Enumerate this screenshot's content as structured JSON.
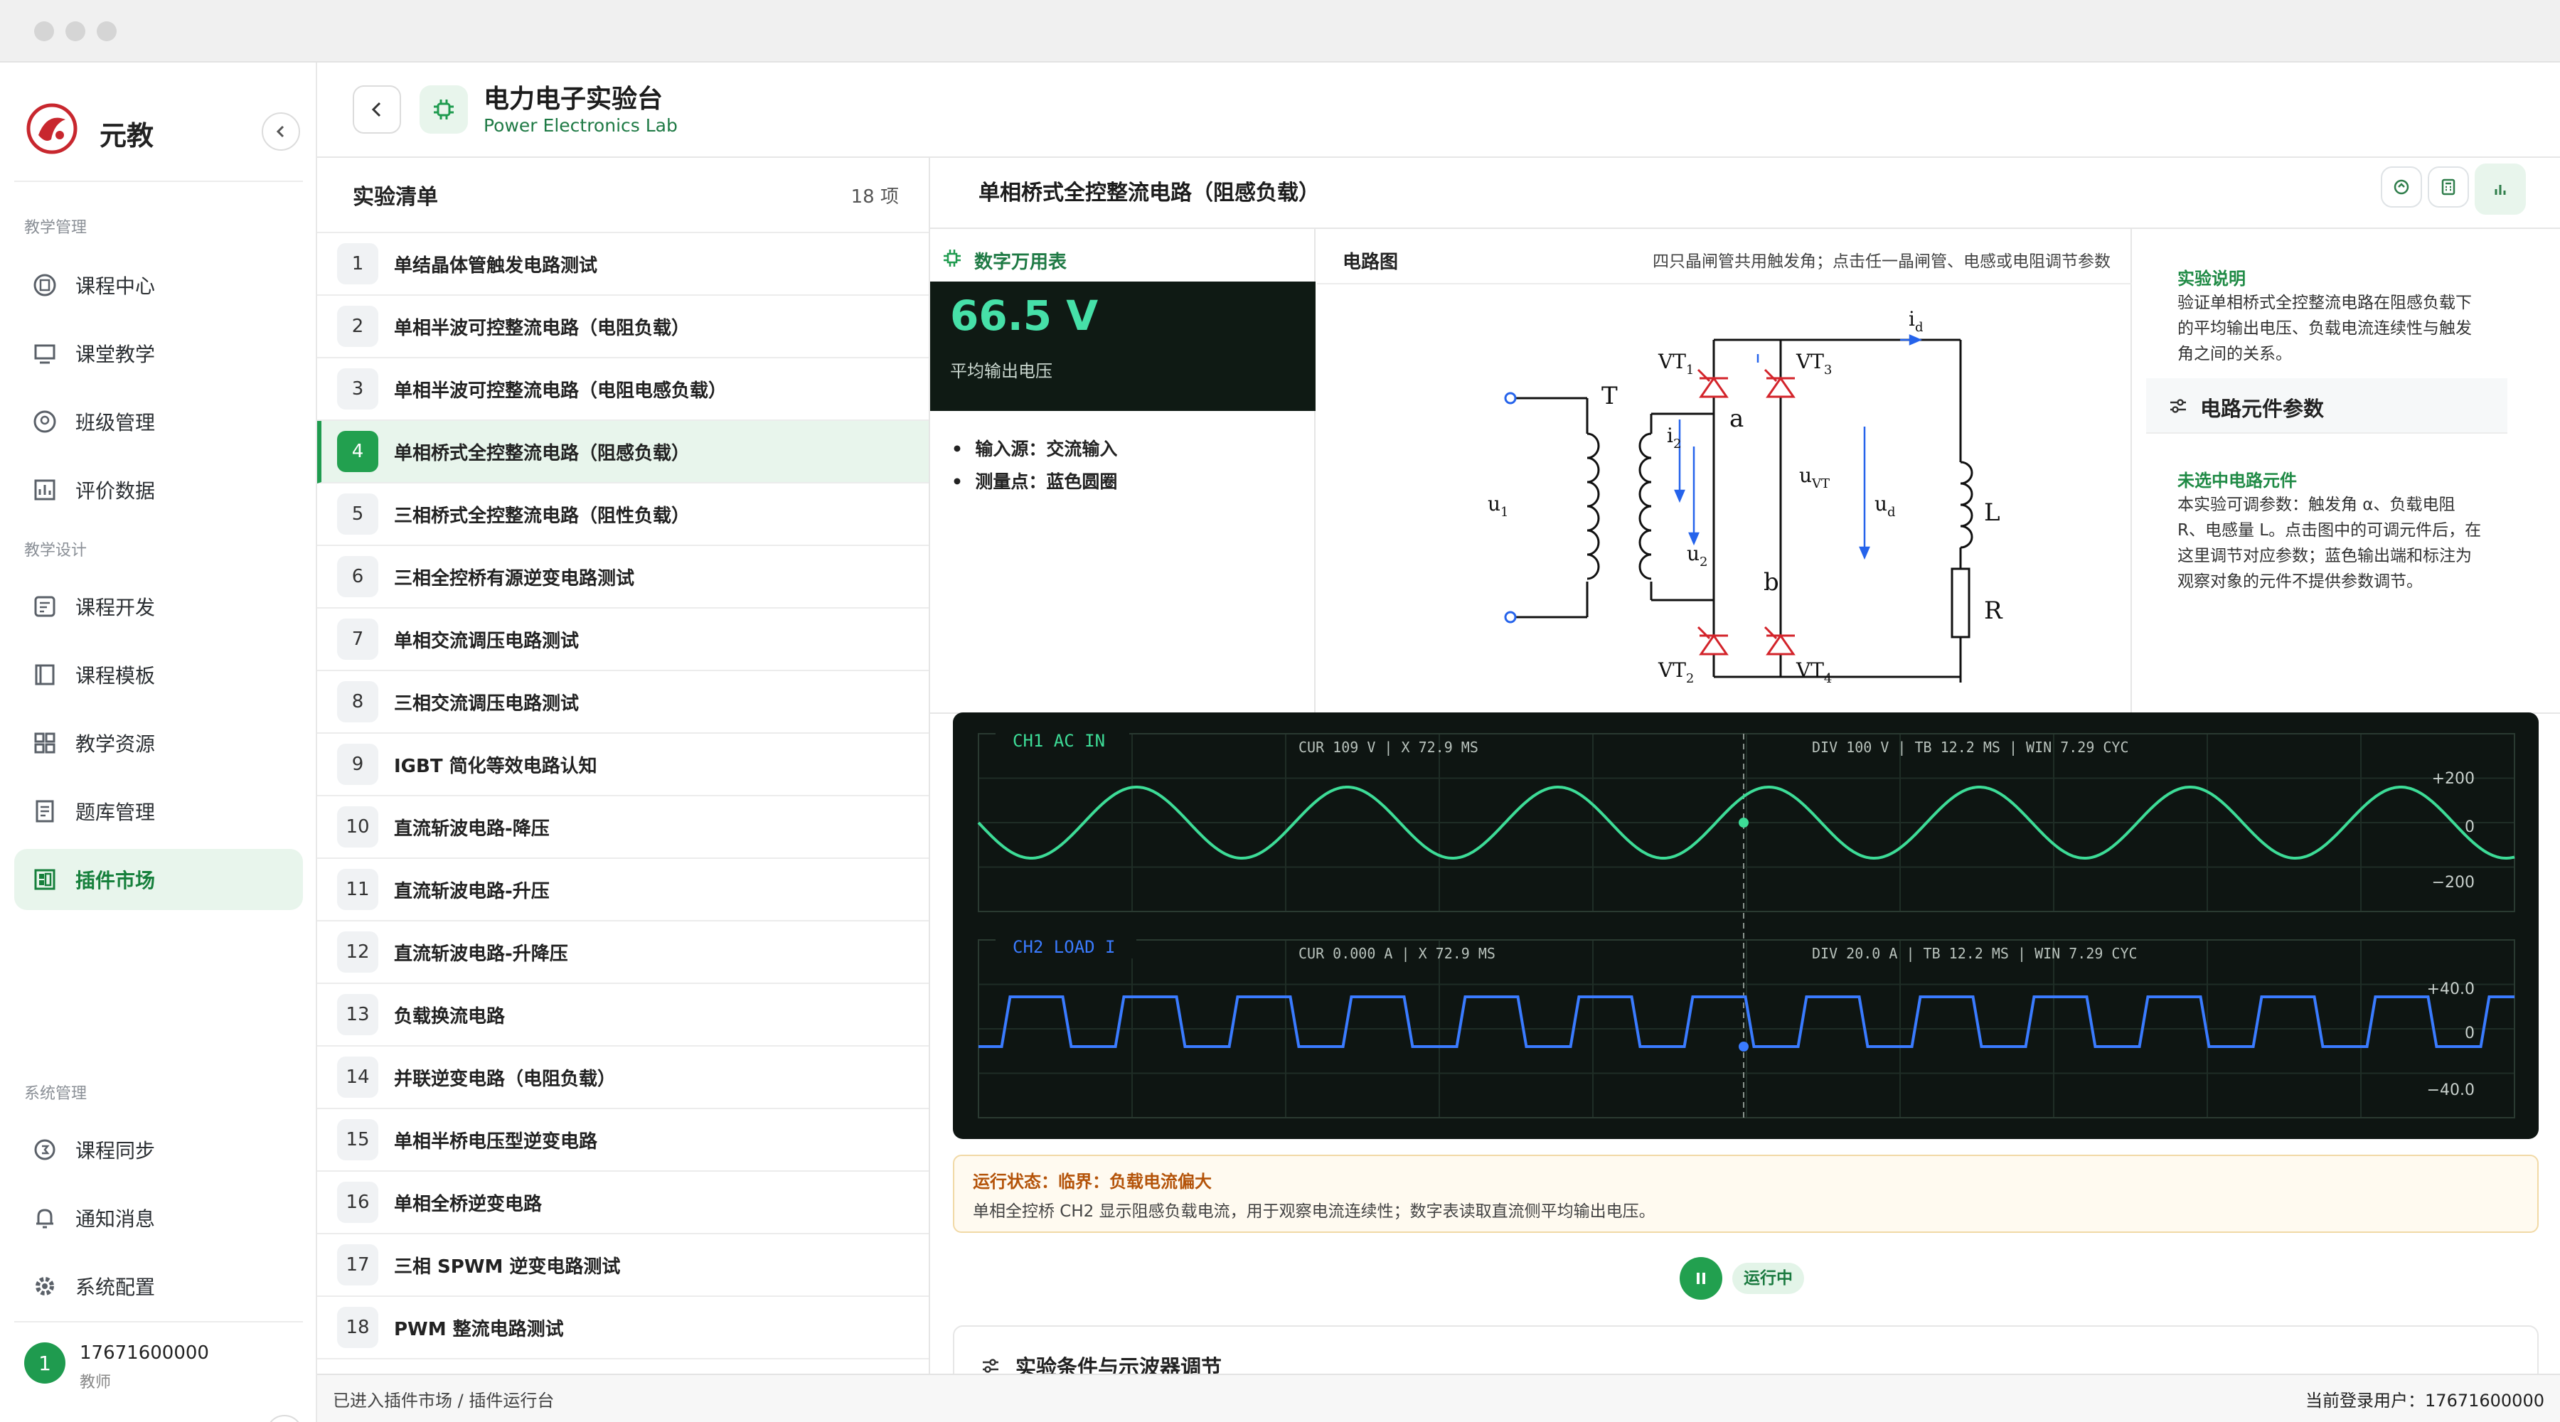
{
  "app": {
    "name": "元教"
  },
  "sidebar": {
    "sections": [
      "教学管理",
      "教学设计",
      "系统管理"
    ],
    "items": [
      {
        "label": "课程中心",
        "icon": "book-icon"
      },
      {
        "label": "课堂教学",
        "icon": "classroom-icon"
      },
      {
        "label": "班级管理",
        "icon": "class-icon"
      },
      {
        "label": "评价数据",
        "icon": "chart-icon"
      },
      {
        "label": "课程开发",
        "icon": "dev-icon"
      },
      {
        "label": "课程模板",
        "icon": "template-icon"
      },
      {
        "label": "教学资源",
        "icon": "resource-icon"
      },
      {
        "label": "题库管理",
        "icon": "question-bank-icon"
      },
      {
        "label": "插件市场",
        "icon": "plugin-icon",
        "active": true
      },
      {
        "label": "课程同步",
        "icon": "sync-icon"
      },
      {
        "label": "通知消息",
        "icon": "bell-icon"
      },
      {
        "label": "系统配置",
        "icon": "gear-icon"
      }
    ],
    "user": {
      "avatar": "1",
      "name": "17671600000",
      "role": "教师"
    }
  },
  "header": {
    "title": "电力电子实验台",
    "subtitle": "Power Electronics Lab"
  },
  "list": {
    "title": "实验清单",
    "count": "18 项",
    "items": [
      {
        "num": "1",
        "label": "单结晶体管触发电路测试"
      },
      {
        "num": "2",
        "label": "单相半波可控整流电路（电阻负载）"
      },
      {
        "num": "3",
        "label": "单相半波可控整流电路（电阻电感负载）"
      },
      {
        "num": "4",
        "label": "单相桥式全控整流电路（阻感负载）"
      },
      {
        "num": "5",
        "label": "三相桥式全控整流电路（阻性负载）"
      },
      {
        "num": "6",
        "label": "三相全控桥有源逆变电路测试"
      },
      {
        "num": "7",
        "label": "单相交流调压电路测试"
      },
      {
        "num": "8",
        "label": "三相交流调压电路测试"
      },
      {
        "num": "9",
        "label": "IGBT 简化等效电路认知"
      },
      {
        "num": "10",
        "label": "直流斩波电路-降压"
      },
      {
        "num": "11",
        "label": "直流斩波电路-升压"
      },
      {
        "num": "12",
        "label": "直流斩波电路-升降压"
      },
      {
        "num": "13",
        "label": "负载换流电路"
      },
      {
        "num": "14",
        "label": "并联逆变电路（电阻负载）"
      },
      {
        "num": "15",
        "label": "单相半桥电压型逆变电路"
      },
      {
        "num": "16",
        "label": "单相全桥逆变电路"
      },
      {
        "num": "17",
        "label": "三相 SPWM 逆变电路测试"
      },
      {
        "num": "18",
        "label": "PWM 整流电路测试"
      }
    ],
    "active_index": 3
  },
  "experiment": {
    "title": "单相桥式全控整流电路（阻感负载）",
    "meter": {
      "title": "数字万用表",
      "value": "66.5 V",
      "label": "平均输出电压",
      "bullets": [
        "输入源：交流输入",
        "测量点：蓝色圆圈"
      ]
    },
    "circuit": {
      "title": "电路图",
      "hint": "四只晶闸管共用触发角；点击任一晶闸管、电感或电阻调节参数",
      "labels": {
        "T": "T",
        "a": "a",
        "b": "b",
        "L": "L",
        "R": "R"
      }
    },
    "info": {
      "desc_title": "实验说明",
      "desc": "验证单相桥式全控整流电路在阻感负载下的平均输出电压、负载电流连续性与触发角之间的关系。",
      "params_title": "电路元件参数",
      "unselected_title": "未选中电路元件",
      "unselected_desc": "本实验可调参数：触发角 α、负载电阻 R、电感量 L。点击图中的可调元件后，在这里调节对应参数；蓝色输出端和标注为观察对象的元件不提供参数调节。"
    },
    "scope": {
      "ch1": {
        "name": "CH1 AC IN",
        "cur": "CUR 109 V | X 72.9 MS",
        "div": "DIV 100 V | TB 12.2 MS | WIN 7.29 CYC",
        "ticks": [
          "+200",
          "0",
          "−200"
        ],
        "color": "#3ddc97",
        "cycles": 7.29
      },
      "ch2": {
        "name": "CH2 LOAD I",
        "cur": "CUR 0.000 A | X 72.9 MS",
        "div": "DIV 20.0 A | TB 12.2 MS | WIN 7.29 CYC",
        "ticks": [
          "+40.0",
          "0",
          "−40.0"
        ],
        "color": "#3a7bff",
        "cycles": 7.29
      }
    },
    "status": {
      "title": "运行状态：临界：负载电流偏大",
      "desc": "单相全控桥 CH2 显示阻感负载电流，用于观察电流连续性；数字表读取直流侧平均输出电压。"
    },
    "run_label": "运行中",
    "conditions_title": "实验条件与示波器调节"
  },
  "statusbar": {
    "left": "已进入插件市场 / 插件运行台",
    "right": "当前登录用户：17671600000"
  }
}
